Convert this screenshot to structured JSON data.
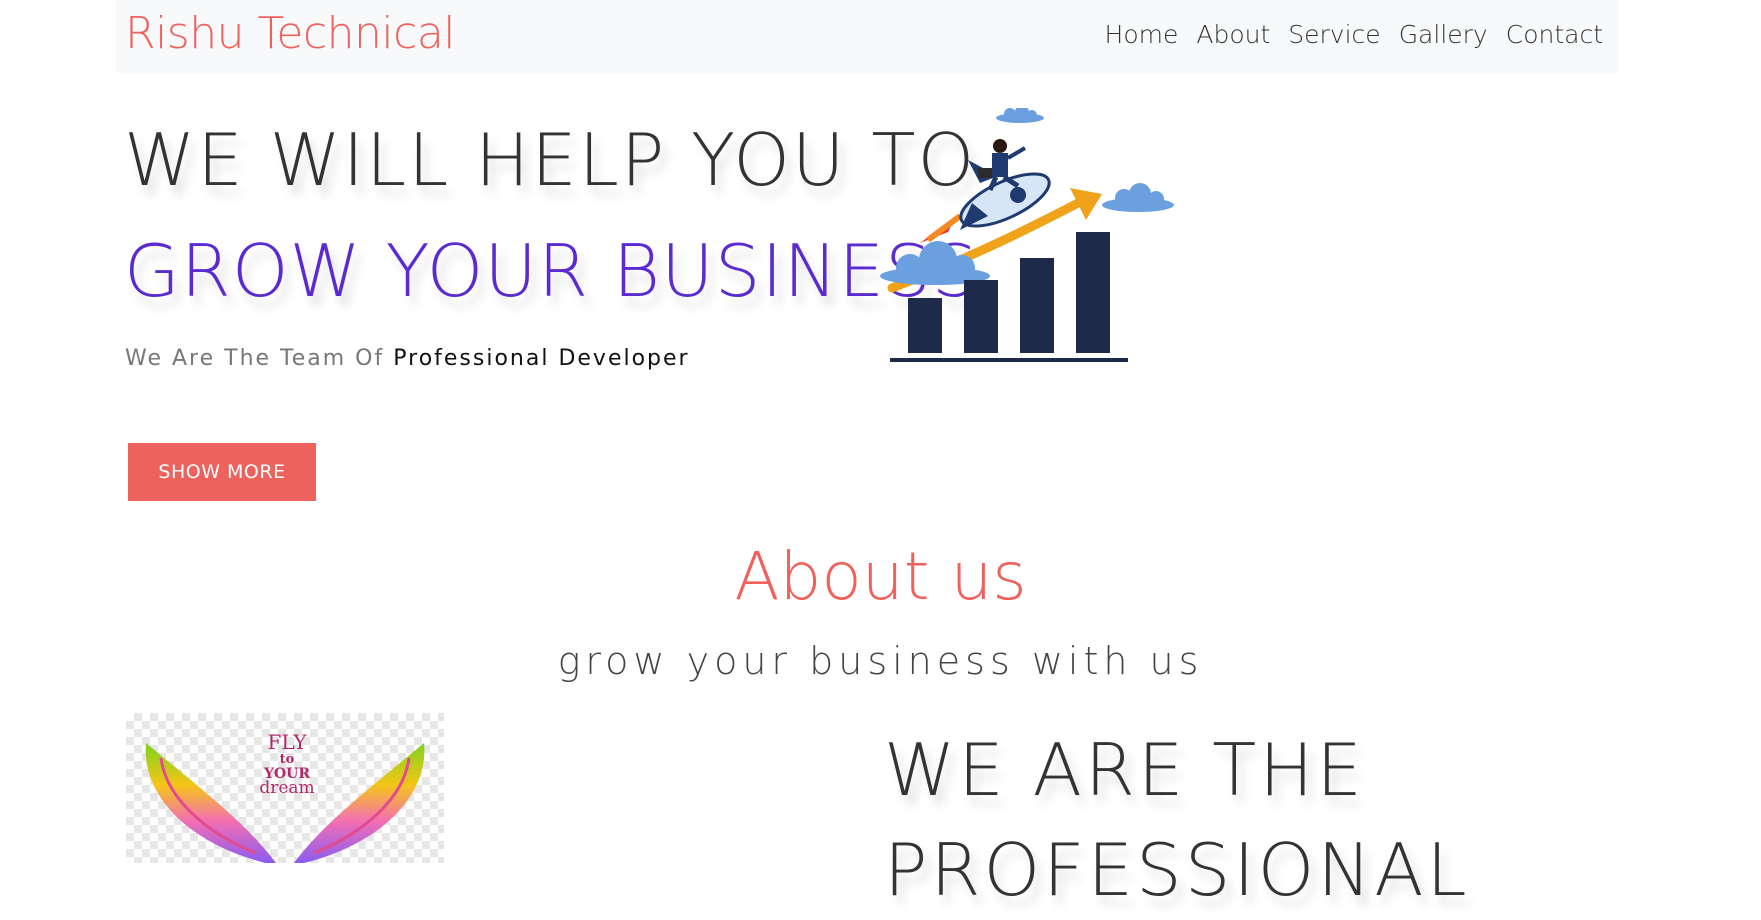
{
  "navbar": {
    "brand": "Rishu Technical",
    "links": [
      "Home",
      "About",
      "Service",
      "Gallery",
      "Contact"
    ]
  },
  "hero": {
    "line1": "WE WILL HELP YOU TO",
    "line2": "GROW YOUR BUSINESS",
    "subtitle_plain": "We Are The Team Of ",
    "subtitle_emphasis": "Professional Developer",
    "button_label": "SHOW MORE"
  },
  "about": {
    "title": "About us",
    "subtitle": "grow your business with us",
    "image_text": {
      "l1": "FLY",
      "l2": "to",
      "l3": "YOUR",
      "l4": "dream"
    },
    "heading_line1": "WE ARE THE",
    "heading_line2": "PROFESSIONAL"
  },
  "colors": {
    "accent": "#f0615c",
    "hero_purple": "#5b2bd1",
    "nav_bg": "#f8f9fa",
    "button": "#ee625d"
  }
}
